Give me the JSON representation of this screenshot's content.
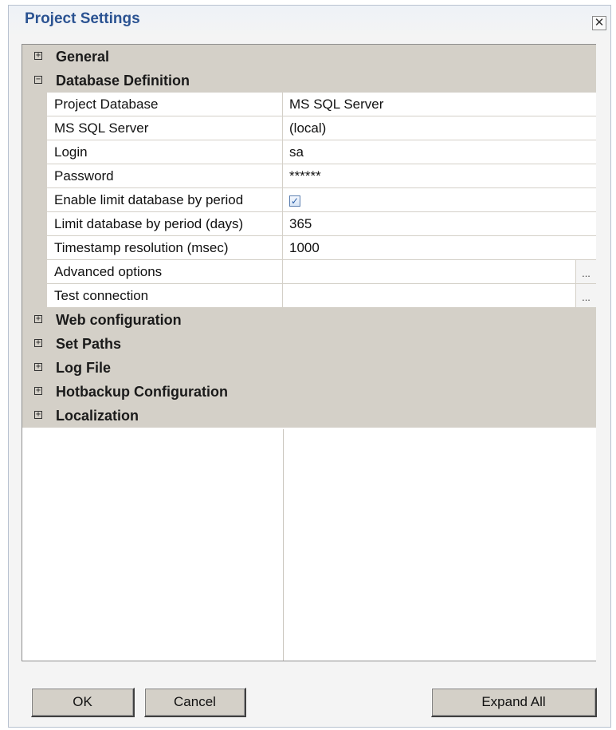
{
  "window": {
    "title": "Project Settings",
    "close_glyph": "✕"
  },
  "grid": {
    "categories": [
      {
        "label": "General",
        "expanded": false,
        "toggle": "+"
      },
      {
        "label": "Database Definition",
        "expanded": true,
        "toggle": "−"
      },
      {
        "label": "Web configuration",
        "expanded": false,
        "toggle": "+"
      },
      {
        "label": "Set Paths",
        "expanded": false,
        "toggle": "+"
      },
      {
        "label": "Log File",
        "expanded": false,
        "toggle": "+"
      },
      {
        "label": "Hotbackup Configuration",
        "expanded": false,
        "toggle": "+"
      },
      {
        "label": "Localization",
        "expanded": false,
        "toggle": "+"
      }
    ],
    "properties": [
      {
        "name": "Project Database",
        "value": "MS SQL Server"
      },
      {
        "name": "MS SQL Server",
        "value": "(local)"
      },
      {
        "name": "Login",
        "value": "sa"
      },
      {
        "name": "Password",
        "value": "******"
      },
      {
        "name": "Enable limit database by period",
        "value": "",
        "checked": true,
        "check_glyph": "✓"
      },
      {
        "name": "Limit database by period (days)",
        "value": "365"
      },
      {
        "name": "Timestamp resolution (msec)",
        "value": "1000"
      },
      {
        "name": "Advanced options",
        "value": "",
        "ellipsis": "..."
      },
      {
        "name": "Test connection",
        "value": "",
        "ellipsis": "..."
      }
    ]
  },
  "buttons": {
    "ok": "OK",
    "cancel": "Cancel",
    "expand_all": "Expand All"
  },
  "colors": {
    "title": "#2b5392",
    "category_bg": "#d4d0c8",
    "grid_bg": "#ffffff"
  },
  "icons": {
    "expand": "plus-box-icon",
    "collapse": "minus-box-icon",
    "close": "close-icon",
    "checkbox": "checkbox-checked-icon",
    "ellipsis": "ellipsis-icon"
  }
}
